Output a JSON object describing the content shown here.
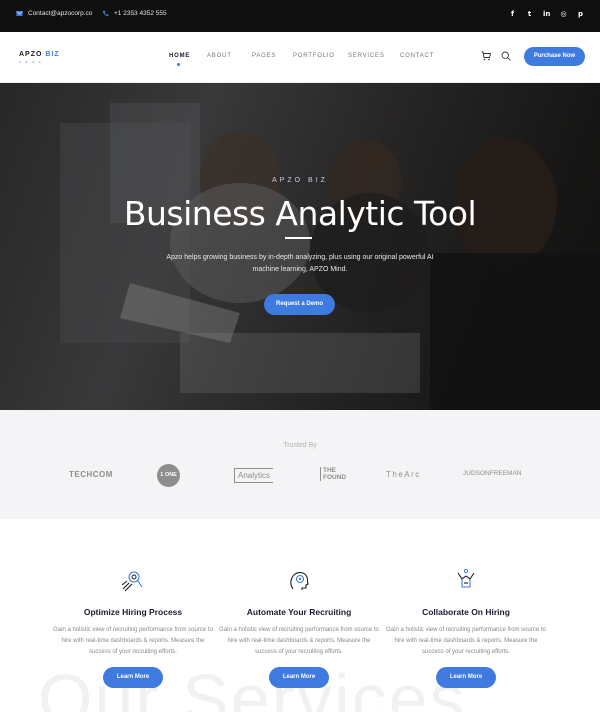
{
  "topbar": {
    "email": "Contact@apzocorp.co",
    "phone": "+1 2353 4352 555",
    "socials": [
      {
        "name": "facebook-icon",
        "glyph": "f"
      },
      {
        "name": "twitter-icon",
        "glyph": "t"
      },
      {
        "name": "linkedin-icon",
        "glyph": "in"
      },
      {
        "name": "instagram-icon",
        "glyph": "◎"
      },
      {
        "name": "pinterest-icon",
        "glyph": "p"
      }
    ]
  },
  "header": {
    "logo": {
      "apzo": "APZO",
      "biz": "BIZ"
    },
    "nav": [
      "HOME",
      "ABOUT",
      "PAGES",
      "PORTFOLIO",
      "SERVICES",
      "CONTACT"
    ],
    "active_nav": "HOME",
    "purchase_label": "Purchase Now"
  },
  "hero": {
    "eyebrow": "APZO BIZ",
    "title": "Business Analytic Tool",
    "subtitle": "Apzo helps growing business by in-depth analyzing, plus using our original powerful AI machine learning, APZO Mind.",
    "cta_label": "Request a Demo"
  },
  "trusted": {
    "label": "Trusted By",
    "brands": [
      "TECHCOM",
      "1 ONE",
      "Analytics",
      "THE FOUND",
      "TheArc",
      "JUDSONFREEMAN"
    ]
  },
  "services": {
    "watermark": "Our Services",
    "cards": [
      {
        "title": "Optimize Hiring Process",
        "desc": "Gain a holistic view of recruiting performance from source to hire with real-time dashboards & reports. Measure the success of your recruiting efforts.",
        "button": "Learn More"
      },
      {
        "title": "Automate Your Recruiting",
        "desc": "Gain a holistic view of recruiting performance from source to hire with real-time dashboards & reports. Measure the success of your recruiting efforts.",
        "button": "Learn More"
      },
      {
        "title": "Collaborate On Hiring",
        "desc": "Gain a holistic view of recruiting performance from source to hire with real-time dashboards & reports. Measure the success of your recruiting efforts.",
        "button": "Learn More"
      }
    ]
  },
  "colors": {
    "accent": "#3f7ae0",
    "topbar": "#0f0f10",
    "trusted_bg": "#f4f4f6"
  }
}
